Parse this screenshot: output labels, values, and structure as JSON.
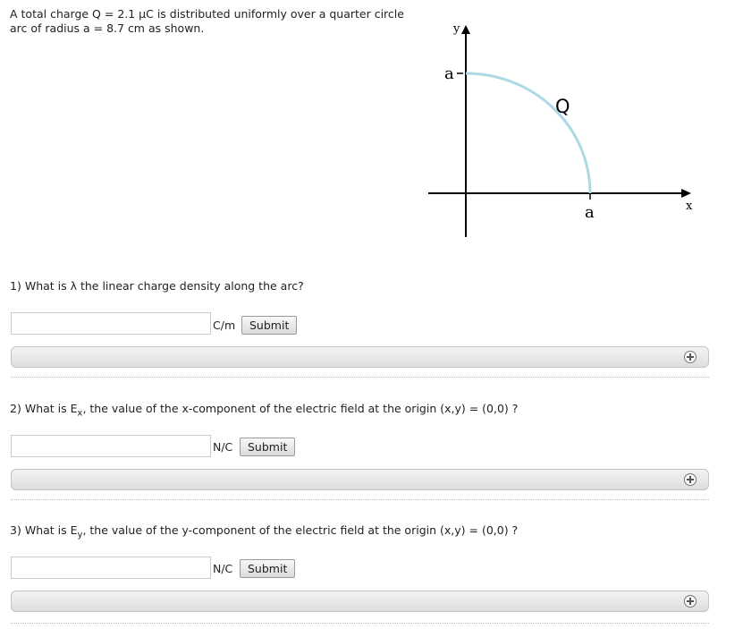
{
  "problem": {
    "line1": "A total charge Q = 2.1 μC is distributed uniformly over a quarter circle",
    "line2": "arc of radius a = 8.7 cm as shown."
  },
  "figure": {
    "y_axis_label": "y",
    "x_axis_label": "x",
    "a_y_label": "a",
    "a_x_label": "a",
    "charge_label": "Q",
    "arc_color": "#add8e6",
    "axis_color": "#000000"
  },
  "questions": [
    {
      "number": "1)",
      "text": "What is λ the linear charge density along the arc?",
      "input_value": "",
      "unit": "C/m",
      "submit_label": "Submit"
    },
    {
      "number": "2)",
      "pre": "What is E",
      "sub": "x",
      "post": ", the value of the x-component of the electric field at the origin (x,y) = (0,0) ?",
      "input_value": "",
      "unit": "N/C",
      "submit_label": "Submit"
    },
    {
      "number": "3)",
      "pre": "What is E",
      "sub": "y",
      "post": ", the value of the y-component of the electric field at the origin (x,y) = (0,0) ?",
      "input_value": "",
      "unit": "N/C",
      "submit_label": "Submit"
    }
  ],
  "hint_icon": "plus-circle-icon"
}
